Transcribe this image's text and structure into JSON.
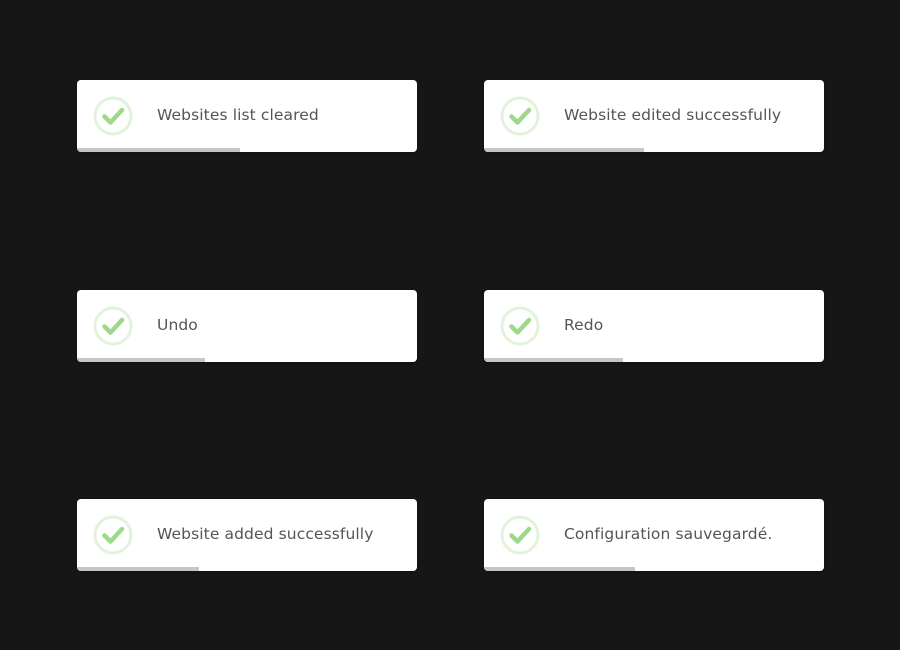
{
  "theme": {
    "background": "#161616",
    "toast_background": "#ffffff",
    "icon_color": "#9ed88a",
    "icon_ring_color": "#e2f3dc",
    "text_color": "#555555",
    "progress_color": "#c6c6c6"
  },
  "toasts": [
    {
      "icon": "success-check-icon",
      "message": "Websites list cleared",
      "progress": 0.48
    },
    {
      "icon": "success-check-icon",
      "message": "Website edited successfully",
      "progress": 0.47
    },
    {
      "icon": "success-check-icon",
      "message": "Undo",
      "progress": 0.375
    },
    {
      "icon": "success-check-icon",
      "message": "Redo",
      "progress": 0.41
    },
    {
      "icon": "success-check-icon",
      "message": "Website added successfully",
      "progress": 0.36
    },
    {
      "icon": "success-check-icon",
      "message": "Configuration sauvegardé.",
      "progress": 0.445
    }
  ]
}
